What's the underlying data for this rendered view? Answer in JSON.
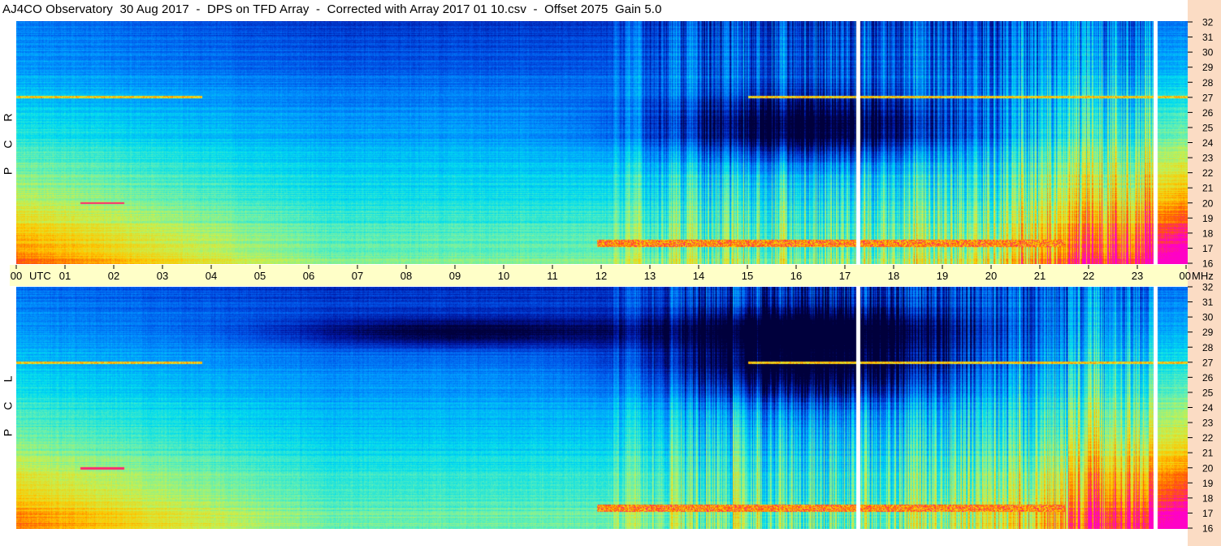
{
  "title": "AJ4CO Observatory  30 Aug 2017  -  DPS on TFD Array  -  Corrected with Array 2017 01 10.csv  -  Offset 2075  Gain 5.0",
  "panels": {
    "top_label": "R C P",
    "bottom_label": "L C P"
  },
  "colors": {
    "utc_bar": "#ffffc8",
    "freq_strip": "#fbdcc4",
    "colormap": [
      "#00003c",
      "#0014a0",
      "#0050e6",
      "#0096ff",
      "#00dcf0",
      "#64f0b4",
      "#c8f050",
      "#ffc800",
      "#ff5a00",
      "#ff00c8"
    ]
  },
  "chart_data": {
    "type": "heatmap",
    "description": "Dynamic spectrum (time vs frequency), two polarizations",
    "x_axis": {
      "ticks": [
        "00",
        "01",
        "02",
        "03",
        "04",
        "05",
        "06",
        "07",
        "08",
        "09",
        "10",
        "11",
        "12",
        "13",
        "14",
        "15",
        "16",
        "17",
        "18",
        "19",
        "20",
        "21",
        "22",
        "23",
        "00"
      ],
      "utc_label": "UTC",
      "xlim": [
        0,
        24
      ]
    },
    "y_axis": {
      "ticks": [
        "32",
        "31",
        "30",
        "29",
        "28",
        "27",
        "26",
        "25",
        "24",
        "23",
        "22",
        "21",
        "20",
        "19",
        "18",
        "17",
        "16"
      ],
      "unit": "MHz",
      "ylim": [
        16,
        32
      ]
    },
    "gaps_utc": [
      17.25,
      23.35
    ],
    "series": [
      {
        "panel": "top",
        "polarization": "RCP"
      },
      {
        "panel": "bottom",
        "polarization": "LCP"
      }
    ]
  }
}
